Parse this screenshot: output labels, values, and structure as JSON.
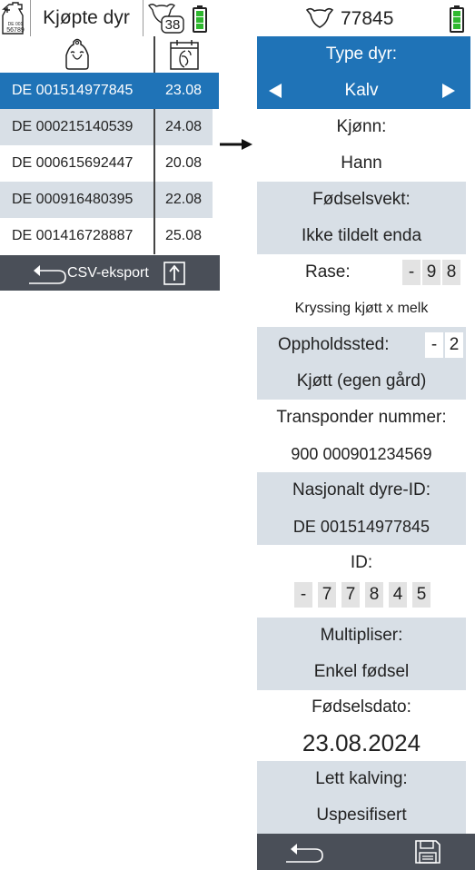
{
  "left": {
    "title": "Kjøpte dyr",
    "badge_count": "38",
    "rows": [
      {
        "id": "DE 001514977845",
        "date": "23.08"
      },
      {
        "id": "DE 000215140539",
        "date": "24.08"
      },
      {
        "id": "DE 000615692447",
        "date": "20.08"
      },
      {
        "id": "DE 000916480395",
        "date": "22.08"
      },
      {
        "id": "DE 001416728887",
        "date": "25.08"
      }
    ],
    "export_label": "CSV-eksport"
  },
  "right": {
    "animal_number": "77845",
    "type_label": "Type dyr:",
    "type_value": "Kalv",
    "sex_label": "Kjønn:",
    "sex_value": "Hann",
    "birth_weight_label": "Fødselsvekt:",
    "birth_weight_value": "Ikke tildelt enda",
    "breed_label": "Rase:",
    "breed_digits": [
      "-",
      "9",
      "8"
    ],
    "breed_value": "Kryssing kjøtt x melk",
    "location_label": "Oppholdssted:",
    "location_digits": [
      "-",
      "2"
    ],
    "location_value": "Kjøtt (egen gård)",
    "transponder_label": "Transponder nummer:",
    "transponder_value": "900 000901234569",
    "national_id_label": "Nasjonalt dyre-ID:",
    "national_id_value": "DE 001514977845",
    "id_label": "ID:",
    "id_digits": [
      "-",
      "7",
      "7",
      "8",
      "4",
      "5"
    ],
    "multiples_label": "Multipliser:",
    "multiples_value": "Enkel fødsel",
    "birth_date_label": "Fødselsdato:",
    "birth_date_value": "23.08.2024",
    "easy_calving_label": "Lett kalving:",
    "easy_calving_value": "Uspesifisert"
  },
  "colors": {
    "accent": "#1f73b7",
    "row_alt": "#d8dfe6",
    "footer": "#4a4f58",
    "battery": "#2fb82f"
  },
  "icons": [
    "cow-tag-icon",
    "cow-head-icon",
    "battery-icon",
    "ear-tag-icon",
    "calendar-icon",
    "back-arrow-icon",
    "export-icon",
    "arrow-left-icon",
    "arrow-right-icon",
    "save-icon",
    "pointer-arrow-icon"
  ]
}
